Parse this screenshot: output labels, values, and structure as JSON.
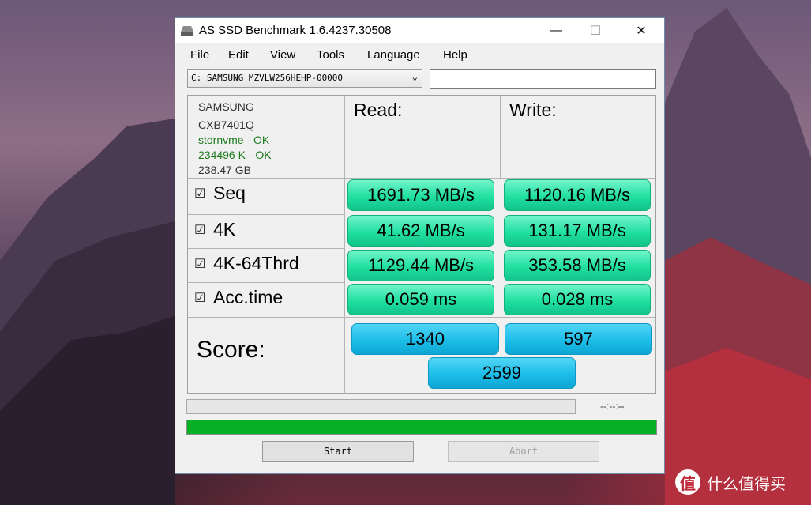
{
  "window": {
    "title": "AS SSD Benchmark 1.6.4237.30508",
    "minimize": "—",
    "maximize": "☐",
    "close": "✕"
  },
  "menu": {
    "items": [
      "File",
      "Edit",
      "View",
      "Tools",
      "Language",
      "Help"
    ]
  },
  "drive": {
    "selected": "C: SAMSUNG MZVLW256HEHP-00000",
    "arrow": "⌄"
  },
  "info": {
    "vendor": "SAMSUNG",
    "firmware": "CXB7401Q",
    "driver": "stornvme - OK",
    "alignment": "234496 K - OK",
    "size": "238.47 GB"
  },
  "columns": {
    "read": "Read:",
    "write": "Write:"
  },
  "rows": [
    {
      "label": "Seq",
      "checked": true,
      "read": "1691.73 MB/s",
      "write": "1120.16 MB/s"
    },
    {
      "label": "4K",
      "checked": true,
      "read": "41.62 MB/s",
      "write": "131.17 MB/s"
    },
    {
      "label": "4K-64Thrd",
      "checked": true,
      "read": "1129.44 MB/s",
      "write": "353.58 MB/s"
    },
    {
      "label": "Acc.time",
      "checked": true,
      "read": "0.059 ms",
      "write": "0.028 ms"
    }
  ],
  "checkbox_glyph": "☑",
  "score": {
    "label": "Score:",
    "read": "1340",
    "write": "597",
    "total": "2599"
  },
  "progress": {
    "elapsed": "--:--:--",
    "top_fraction": 0.0,
    "bottom_fraction": 1.0
  },
  "buttons": {
    "start": "Start",
    "abort": "Abort"
  },
  "watermark": {
    "logo": "值",
    "text": "什么值得买"
  },
  "colors": {
    "result_green": "#20e0a0",
    "score_blue": "#1cbde8",
    "progress_green": "#06b025",
    "ok_text": "#1e7b1e"
  }
}
